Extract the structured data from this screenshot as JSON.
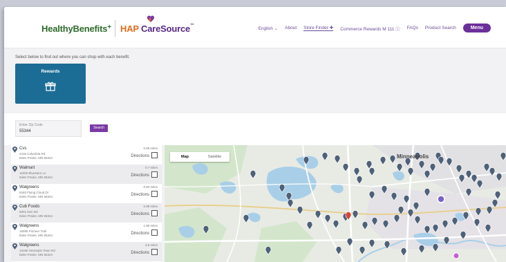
{
  "header": {
    "brand_healthybenefits": "HealthyBenefits",
    "brand_plus": "+",
    "brand_hap": "HAP ",
    "brand_caresource": "CareSource",
    "brand_tm": "™",
    "nav": [
      {
        "label": "English ⌄",
        "active": false
      },
      {
        "label": "About",
        "active": false
      },
      {
        "label": "Store Finder ✚",
        "active": true
      },
      {
        "label": "Commerce Rewards M 111 ⓘ",
        "active": false
      },
      {
        "label": "FAQs",
        "active": false
      },
      {
        "label": "Product Search",
        "active": false
      }
    ],
    "menu_label": "Menu"
  },
  "intro": "Select below to find out where you can shop with each benefit.",
  "benefit_tile": {
    "label": "Rewards",
    "icon": "gift-icon"
  },
  "search": {
    "zip_label": "Enter Zip Code",
    "zip_value": "55344",
    "button_label": "Search"
  },
  "results": [
    {
      "name": "Cvs",
      "address": "4416 Columbia Rd",
      "city": "Eden Prairie, MN 55344",
      "distance": "0.69 miles",
      "directions": "Directions"
    },
    {
      "name": "Walmart",
      "address": "11000 Bluestem Ln",
      "city": "Eden Prairie, MN 55344",
      "distance": "0.7 miles",
      "directions": "Directions"
    },
    {
      "name": "Walgreens",
      "address": "8340 Flying Cloud Dr",
      "city": "Eden Prairie, MN 55344",
      "distance": "0.80 miles",
      "directions": "Directions"
    },
    {
      "name": "Cub Foods",
      "address": "8001 Den Rd",
      "city": "Eden Prairie, MN 55344",
      "distance": "0.99 miles",
      "directions": "Directions"
    },
    {
      "name": "Walgreens",
      "address": "16095 Pioneer Trail",
      "city": "Eden Prairie, MN 55344",
      "distance": "1.89 miles",
      "directions": "Directions"
    },
    {
      "name": "Walgreens",
      "address": "10150 Hennepin Town Rd",
      "city": "Eden Prairie, MN 55344",
      "distance": "3.6 miles",
      "directions": "Directions"
    }
  ],
  "map": {
    "tab_map": "Map",
    "tab_satellite": "Satellite",
    "city_label": "Minneapolis"
  },
  "colors": {
    "accent_purple": "#6b2f9a",
    "tile_blue": "#1b6d95",
    "pin_slate": "#4e6178",
    "pin_selected": "#d6443a"
  }
}
